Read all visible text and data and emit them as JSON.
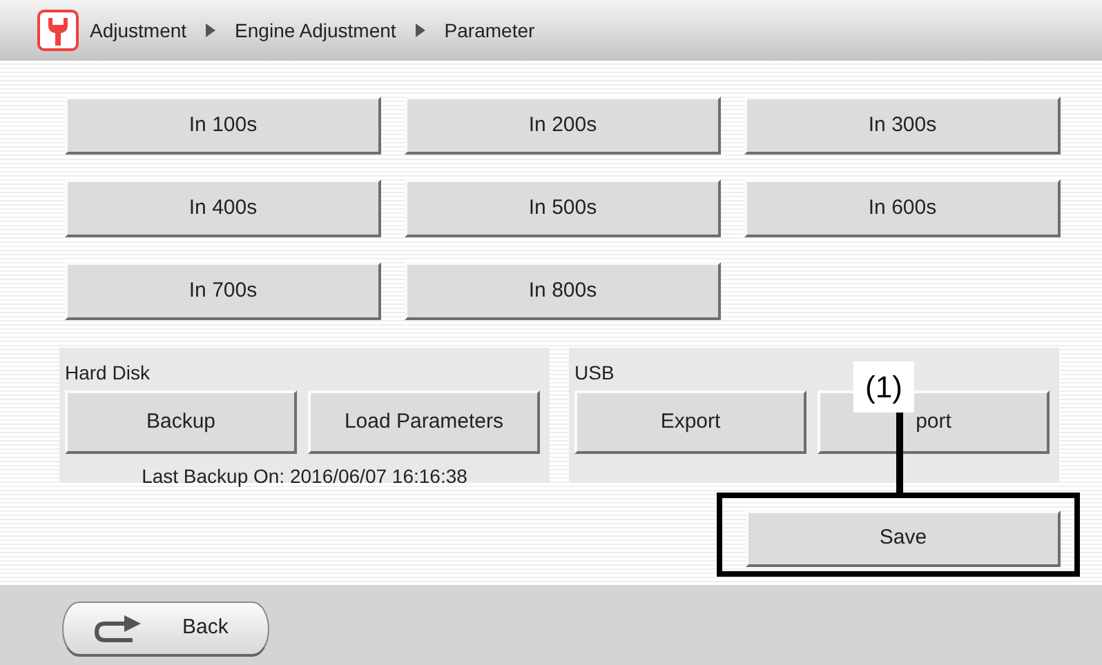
{
  "header": {
    "breadcrumb": [
      {
        "label": "Adjustment"
      },
      {
        "label": "Engine Adjustment"
      },
      {
        "label": "Parameter"
      }
    ]
  },
  "range_buttons": [
    "In 100s",
    "In 200s",
    "In 300s",
    "In 400s",
    "In 500s",
    "In 600s",
    "In 700s",
    "In 800s"
  ],
  "panels": [
    {
      "title": "Hard Disk",
      "buttons": [
        "Backup",
        "Load Parameters"
      ],
      "note": "Last Backup On: 2016/06/07 16:16:38"
    },
    {
      "title": "USB",
      "buttons": [
        "Export",
        "port"
      ]
    }
  ],
  "save_button": "Save",
  "callout": {
    "label": "(1)"
  },
  "footer": {
    "back_button": "Back"
  }
}
